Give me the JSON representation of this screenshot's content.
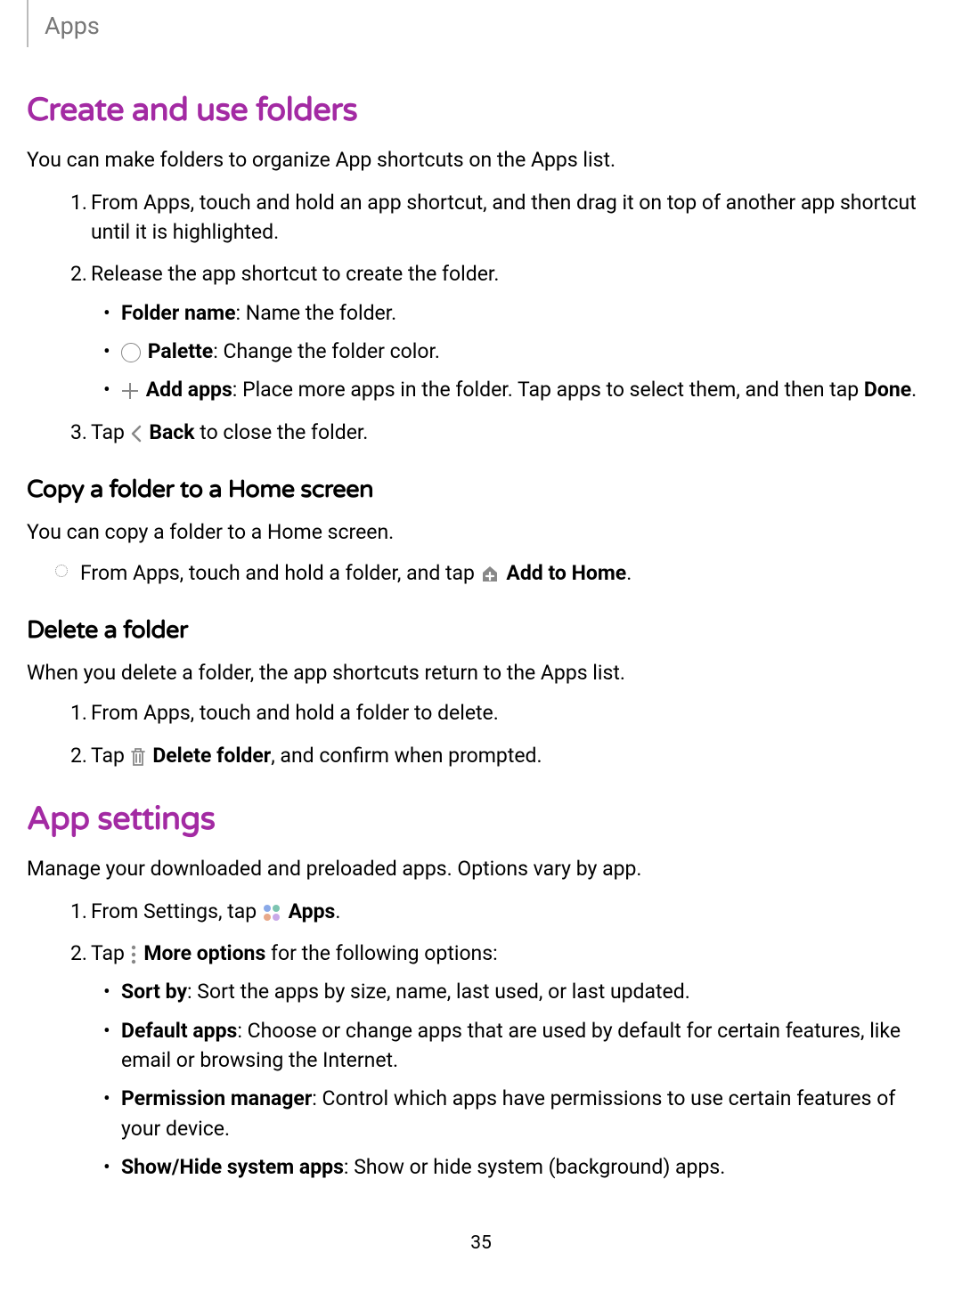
{
  "breadcrumb": "Apps",
  "section1": {
    "title": "Create and use folders",
    "intro": "You can make folders to organize App shortcuts on the Apps list.",
    "step1": "From Apps, touch and hold an app shortcut, and then drag it on top of another app shortcut until it is highlighted.",
    "step2": "Release the app shortcut to create the folder.",
    "step2a_label": "Folder name",
    "step2a_text": ": Name the folder.",
    "step2b_label": "Palette",
    "step2b_text": ": Change the folder color.",
    "step2c_label": "Add apps",
    "step2c_text1": ": Place more apps in the folder. Tap apps to select them, and then tap ",
    "step2c_done": "Done",
    "step2c_text2": ".",
    "step3_tap": "Tap ",
    "step3_back": "Back",
    "step3_rest": " to close the folder."
  },
  "sub_copy": {
    "title": "Copy a folder to a Home screen",
    "intro": "You can copy a folder to a Home screen.",
    "bullet_pre": "From Apps, touch and hold a folder, and tap ",
    "bullet_label": "Add to Home",
    "bullet_post": "."
  },
  "sub_delete": {
    "title": "Delete a folder",
    "intro": "When you delete a folder, the app shortcuts return to the Apps list.",
    "step1": "From Apps, touch and hold a folder to delete.",
    "step2_tap": "Tap ",
    "step2_label": "Delete folder",
    "step2_rest": ", and confirm when prompted."
  },
  "section2": {
    "title": "App settings",
    "intro": "Manage your downloaded and preloaded apps. Options vary by app.",
    "step1_pre": "From Settings, tap ",
    "step1_label": "Apps",
    "step1_post": ".",
    "step2_tap": "Tap ",
    "step2_label": "More options",
    "step2_rest": " for the following options:",
    "opt1_label": "Sort by",
    "opt1_text": ": Sort the apps by size, name, last used, or last updated.",
    "opt2_label": "Default apps",
    "opt2_text": ": Choose or change apps that are used by default for certain features, like email or browsing the Internet.",
    "opt3_label": "Permission manager",
    "opt3_text": ": Control which apps have permissions to use certain features of your device.",
    "opt4_label": "Show/Hide system apps",
    "opt4_text": ": Show or hide system (background) apps."
  },
  "page_number": "35"
}
